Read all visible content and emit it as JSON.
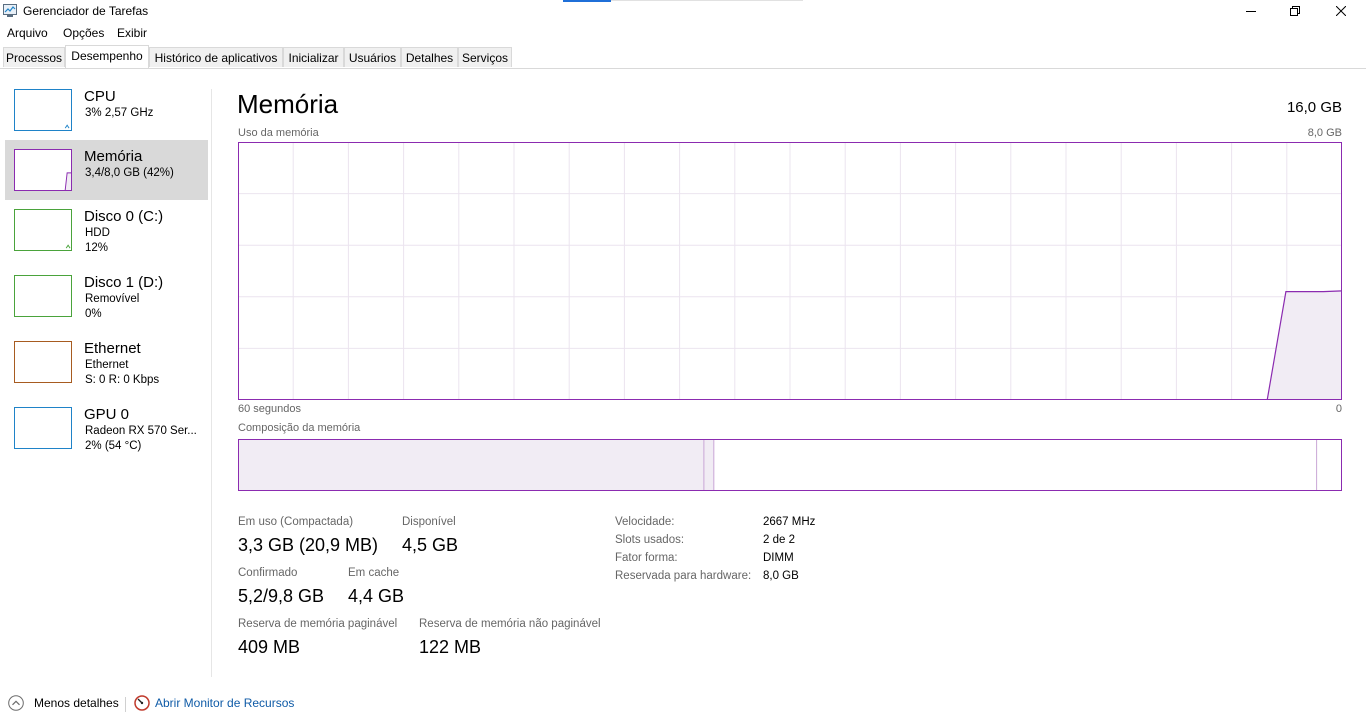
{
  "window": {
    "title": "Gerenciador de Tarefas"
  },
  "menu": [
    "Arquivo",
    "Opções",
    "Exibir"
  ],
  "tabs": [
    {
      "label": "Processos"
    },
    {
      "label": "Desempenho"
    },
    {
      "label": "Histórico de aplicativos"
    },
    {
      "label": "Inicializar"
    },
    {
      "label": "Usuários"
    },
    {
      "label": "Detalhes"
    },
    {
      "label": "Serviços"
    }
  ],
  "active_tab": "Desempenho",
  "sidebar": {
    "items": [
      {
        "name": "CPU",
        "line1": "3% 2,57 GHz",
        "line2": "",
        "color": "#1f83c8"
      },
      {
        "name": "Memória",
        "line1": "3,4/8,0 GB (42%)",
        "line2": "",
        "color": "#8b2bb0"
      },
      {
        "name": "Disco 0 (C:)",
        "line1": "HDD",
        "line2": "12%",
        "color": "#4aa33b"
      },
      {
        "name": "Disco 1 (D:)",
        "line1": "Removível",
        "line2": "0%",
        "color": "#4aa33b"
      },
      {
        "name": "Ethernet",
        "line1": "Ethernet",
        "line2": "S: 0 R: 0 Kbps",
        "color": "#a75b20"
      },
      {
        "name": "GPU 0",
        "line1": "Radeon RX 570 Ser...",
        "line2": "2% (54 °C)",
        "color": "#1f83c8"
      }
    ],
    "selected": "Memória"
  },
  "main": {
    "title": "Memória",
    "total": "16,0 GB",
    "usage_label": "Uso da memória",
    "usage_max": "8,0 GB",
    "time_left": "60 segundos",
    "time_right": "0",
    "composition_label": "Composição da memória",
    "accent_color": "#8b2bb0",
    "fill_color": "#f1ecf4",
    "usage_history_fraction": [
      0,
      0,
      0,
      0,
      0,
      0,
      0,
      0,
      0,
      0,
      0,
      0,
      0,
      0,
      0,
      0,
      0,
      0,
      0,
      0,
      0,
      0,
      0,
      0,
      0,
      0,
      0,
      0,
      0,
      0,
      0,
      0,
      0,
      0,
      0,
      0,
      0,
      0,
      0,
      0,
      0,
      0,
      0,
      0,
      0,
      0,
      0,
      0,
      0,
      0,
      0,
      0,
      0,
      0,
      0,
      0,
      0.42,
      0.42,
      0.42,
      0.423
    ],
    "composition_fractions": {
      "in_use": 0.422,
      "modified": 0.009,
      "standby": 0.546,
      "free": 0.023
    },
    "stats": {
      "in_use_label": "Em uso (Compactada)",
      "in_use_value": "3,3 GB (20,9 MB)",
      "available_label": "Disponível",
      "available_value": "4,5 GB",
      "committed_label": "Confirmado",
      "committed_value": "5,2/9,8 GB",
      "cached_label": "Em cache",
      "cached_value": "4,4 GB",
      "paged_label": "Reserva de memória paginável",
      "paged_value": "409 MB",
      "nonpaged_label": "Reserva de memória não paginável",
      "nonpaged_value": "122 MB"
    },
    "details": [
      {
        "label": "Velocidade:",
        "value": "2667 MHz"
      },
      {
        "label": "Slots usados:",
        "value": "2 de 2"
      },
      {
        "label": "Fator forma:",
        "value": "DIMM"
      },
      {
        "label": "Reservada para hardware:",
        "value": "8,0 GB"
      }
    ]
  },
  "footer": {
    "fewer_details": "Menos detalhes",
    "resource_monitor": "Abrir Monitor de Recursos"
  }
}
